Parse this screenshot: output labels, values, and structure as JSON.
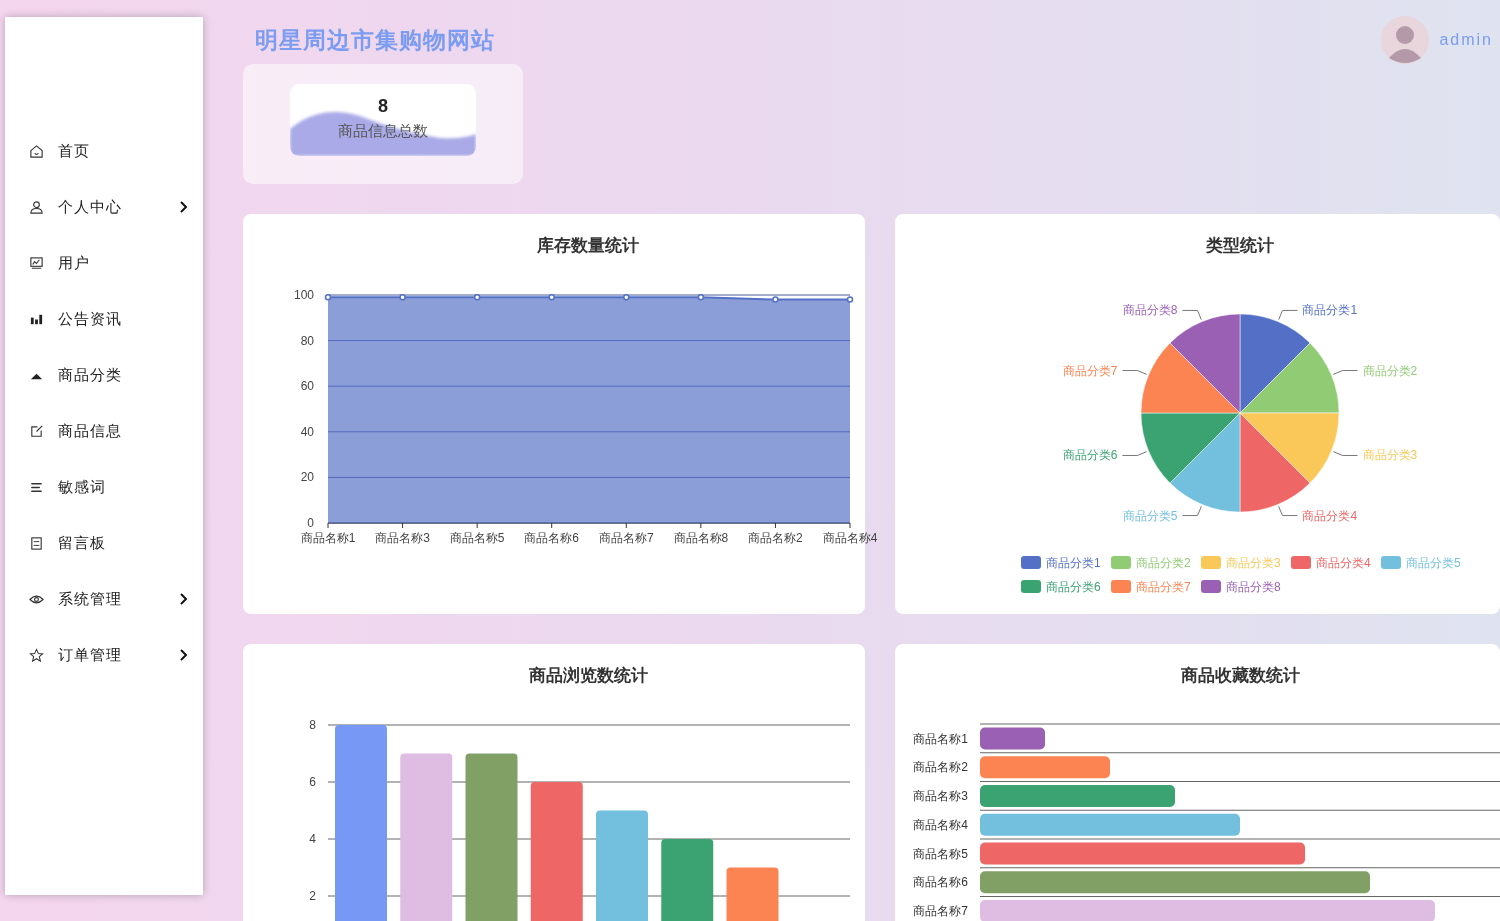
{
  "site_title": "明星周边市集购物网站",
  "user": {
    "name": "admin"
  },
  "sidebar": {
    "items": [
      {
        "label": "首页",
        "expandable": false
      },
      {
        "label": "个人中心",
        "expandable": true
      },
      {
        "label": "用户",
        "expandable": false
      },
      {
        "label": "公告资讯",
        "expandable": false
      },
      {
        "label": "商品分类",
        "expandable": false
      },
      {
        "label": "商品信息",
        "expandable": false
      },
      {
        "label": "敏感词",
        "expandable": false
      },
      {
        "label": "留言板",
        "expandable": false
      },
      {
        "label": "系统管理",
        "expandable": true
      },
      {
        "label": "订单管理",
        "expandable": true
      }
    ]
  },
  "stats": [
    {
      "value": "8",
      "label": "商品信息总数"
    }
  ],
  "charts": [
    {
      "chart_data": {
        "type": "line",
        "title": "库存数量统计",
        "categories": [
          "商品名称1",
          "商品名称3",
          "商品名称5",
          "商品名称6",
          "商品名称7",
          "商品名称8",
          "商品名称2",
          "商品名称4"
        ],
        "series": [
          {
            "type": "line",
            "marker": "circle",
            "color": "#5470c6",
            "values": [
              99,
              99,
              99,
              99,
              99,
              99,
              98,
              98
            ]
          }
        ],
        "ylim": [
          0,
          100
        ],
        "yticks": [
          0,
          20,
          40,
          60,
          80,
          100
        ],
        "grid": true
      }
    },
    {
      "chart_data": {
        "type": "pie",
        "title": "类型统计",
        "categories": [
          "商品分类1",
          "商品分类2",
          "商品分类3",
          "商品分类4",
          "商品分类5",
          "商品分类6",
          "商品分类7",
          "商品分类8"
        ],
        "values": [
          1,
          1,
          1,
          1,
          1,
          1,
          1,
          1
        ],
        "colors": [
          "#5470c6",
          "#91cc75",
          "#fac858",
          "#ee6666",
          "#73c0de",
          "#3ba272",
          "#fc8452",
          "#9a60b4"
        ]
      },
      "legend": [
        {
          "label": "商品分类1"
        },
        {
          "label": "商品分类2"
        },
        {
          "label": "商品分类3"
        },
        {
          "label": "商品分类4"
        },
        {
          "label": "商品分类5"
        },
        {
          "label": "商品分类6"
        },
        {
          "label": "商品分类7"
        },
        {
          "label": "商品分类8"
        }
      ]
    },
    {
      "chart_data": {
        "type": "bar",
        "title": "商品浏览数统计",
        "values": [
          8,
          7,
          7,
          6,
          5,
          4,
          3
        ],
        "colors": [
          "#7799f5",
          "#dfbde3",
          "#80a065",
          "#ee6666",
          "#73c0de",
          "#3ba272",
          "#fc8452"
        ],
        "ylim": [
          0,
          8
        ],
        "yticks": [
          2,
          4,
          6,
          8
        ],
        "grid": true
      }
    },
    {
      "kind": "bar_picture",
      "title": "商品收藏数统计",
      "rows": [
        {
          "label": "商品名称1",
          "color": "#9a60b4"
        },
        {
          "label": "商品名称2",
          "color": "#fc8452"
        },
        {
          "label": "商品名称3",
          "color": "#3ba272"
        },
        {
          "label": "商品名称4",
          "color": "#73c0de"
        },
        {
          "label": "商品名称5",
          "color": "#ee6666"
        },
        {
          "label": "商品名称6",
          "color": "#80a065"
        },
        {
          "label": "商品名称7",
          "color": "#dfbde3"
        }
      ]
    }
  ]
}
